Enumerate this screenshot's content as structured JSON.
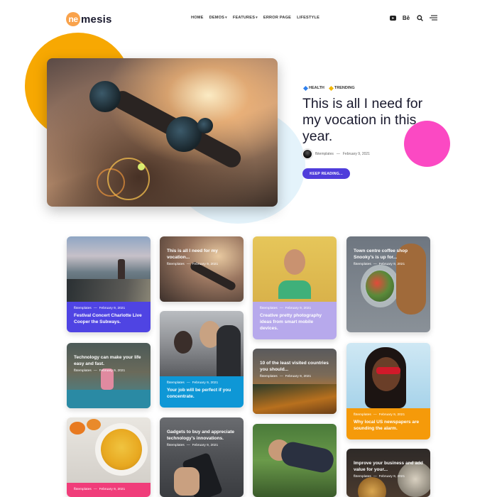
{
  "header": {
    "logo": {
      "mark": "ne",
      "text": "mesis"
    },
    "nav": [
      {
        "label": "HOME",
        "dropdown": false
      },
      {
        "label": "DEMOS",
        "dropdown": true
      },
      {
        "label": "FEATURES",
        "dropdown": true
      },
      {
        "label": "ERROR PAGE",
        "dropdown": false
      },
      {
        "label": "LIFESTYLE",
        "dropdown": false
      }
    ],
    "icons": [
      "youtube-icon",
      "behance-icon",
      "search-icon",
      "menu-icon"
    ],
    "behance_text": "Bē"
  },
  "hero": {
    "tags": [
      {
        "label": "HEALTH",
        "color": "#2f80ed"
      },
      {
        "label": "TRENDING",
        "color": "#f2b705"
      }
    ],
    "title": "This is all I need for my vocation in this year.",
    "author": "fbtemplates",
    "separator": "—",
    "date": "February 9, 2021",
    "button": "KEEP READING..."
  },
  "colors": {
    "accent": "#4f3ddb",
    "orange": "#f7a802",
    "pink": "#fb49c3",
    "light_blue": "#e4f3fb"
  },
  "cards": [
    {
      "author": "fbtemplates",
      "date": "February 9, 2021",
      "title": "Festival Concert Charlotte Live Cooper the Subways.",
      "color": "#4f44e3"
    },
    {
      "author": "fbtemplates",
      "date": "February 9, 2021",
      "title": "This is all I need for my vocation..."
    },
    {
      "author": "fbtemplates",
      "date": "February 9, 2021",
      "title": "Creative pretty photography ideas from smart mobile devices.",
      "color": "#b7a9ec"
    },
    {
      "author": "fbtemplates",
      "date": "February 9, 2021",
      "title": "Town centre coffee shop Snooky's is up for..."
    },
    {
      "author": "fbtemplates",
      "date": "February 9, 2021",
      "title": "Technology can make your life easy and fast."
    },
    {
      "author": "fbtemplates",
      "date": "February 9, 2021",
      "title": "Your job will be perfect if you concentrate.",
      "color": "#0e97d6"
    },
    {
      "author": "fbtemplates",
      "date": "February 9, 2021",
      "title": "10 of the least visited countries you should..."
    },
    {
      "author": "fbtemplates",
      "date": "February 9, 2021",
      "title": "Why local US newspapers are sounding the alarm.",
      "color": "#f59a0a"
    },
    {
      "author": "fbtemplates",
      "date": "February 9, 2021",
      "title": "",
      "color": "#f03d7a"
    },
    {
      "author": "fbtemplates",
      "date": "February 9, 2021",
      "title": "Gadgets to buy and appreciate technology's innovations."
    },
    {
      "author": "",
      "date": "",
      "title": ""
    },
    {
      "author": "fbtemplates",
      "date": "February 9, 2021",
      "title": "Improve your business and add value for your..."
    }
  ]
}
